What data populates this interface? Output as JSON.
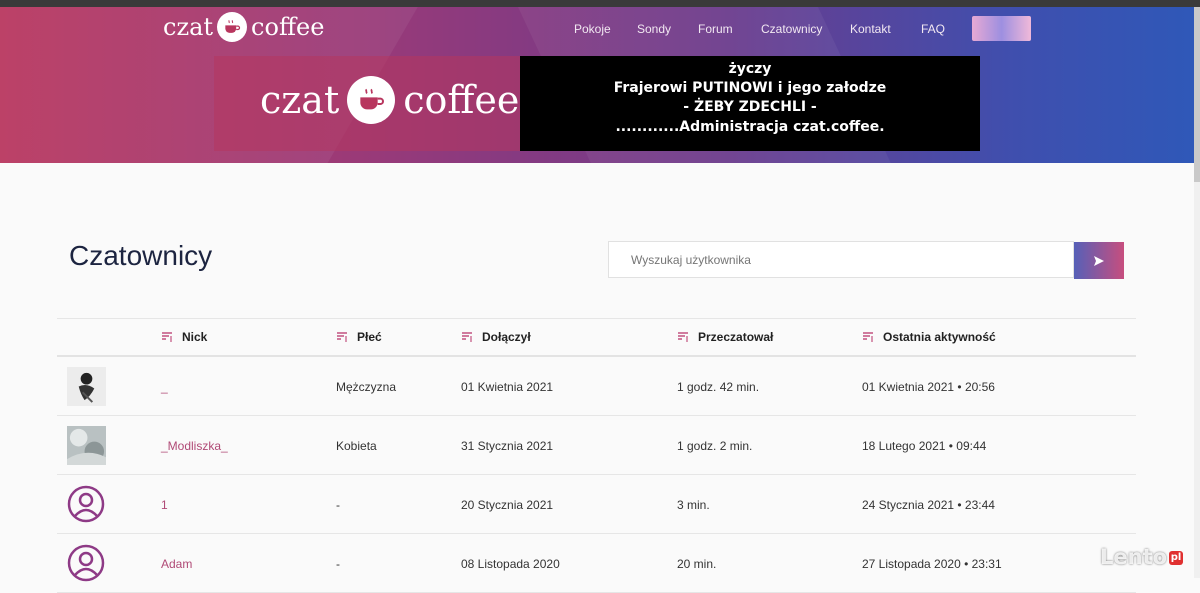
{
  "brand": {
    "logo_text_left": "czat",
    "logo_text_right": "coffee"
  },
  "nav": {
    "items": [
      "Pokoje",
      "Sondy",
      "Forum",
      "Czatownicy",
      "Kontakt",
      "FAQ"
    ]
  },
  "banner": {
    "lines": [
      "życzy",
      "Frajerowi  PUTINOWI i jego załodze",
      "- ŻEBY ZDECHLI -",
      "............Administracja czat.coffee."
    ]
  },
  "page": {
    "title": "Czatownicy"
  },
  "search": {
    "placeholder": "Wyszukaj użytkownika",
    "button_icon": "send-arrow-icon"
  },
  "table": {
    "columns": [
      "Nick",
      "Płeć",
      "Dołączył",
      "Przeczatował",
      "Ostatnia aktywność"
    ],
    "rows": [
      {
        "avatar": "photo",
        "nick": "_",
        "gender": "Mężczyzna",
        "joined": "01 Kwietnia 2021",
        "chat_time": "1 godz. 42 min.",
        "last_active": "01 Kwietnia 2021 • 20:56"
      },
      {
        "avatar": "photo",
        "nick": "_Modliszka_",
        "gender": "Kobieta",
        "joined": "31 Stycznia 2021",
        "chat_time": "1 godz. 2 min.",
        "last_active": "18 Lutego 2021 • 09:44"
      },
      {
        "avatar": "user-icon",
        "nick": "1",
        "gender": "-",
        "joined": "20 Stycznia 2021",
        "chat_time": "3 min.",
        "last_active": "24 Stycznia 2021 • 23:44"
      },
      {
        "avatar": "user-icon",
        "nick": "Adam",
        "gender": "-",
        "joined": "08 Listopada 2020",
        "chat_time": "20 min.",
        "last_active": "27 Listopada 2020 • 23:31"
      }
    ]
  },
  "watermark": {
    "text": "Lento",
    "badge": "pl"
  },
  "colors": {
    "accent": "#b04a76",
    "header_start": "#b8365e",
    "header_end": "#2f58b8",
    "avatar_icon": "#8e3a86"
  }
}
